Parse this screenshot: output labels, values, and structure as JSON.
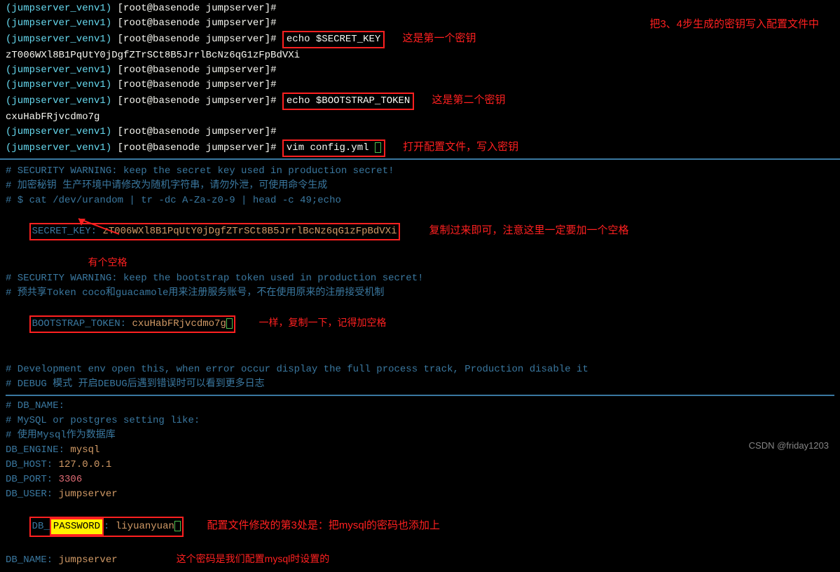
{
  "terminal": {
    "prompt_venv": "(jumpserver_venv1)",
    "prompt_user": "[root@basenode jumpserver]#",
    "cmd_echo_secret": "echo $SECRET_KEY",
    "secret_key_value": "zT006WXl8B1PqUtY0jDgfZTrSCt8B5JrrlBcNz6qG1zFpBdVXi",
    "cmd_echo_bootstrap": "echo $BOOTSTRAP_TOKEN",
    "bootstrap_value": "cxuHabFRjvcdmo7g",
    "cmd_vim": "vim config.yml"
  },
  "annotations": {
    "top_main": "把3、4步生成的密钥写入配置文件中",
    "first_key": "这是第一个密钥",
    "second_key": "这是第二个密钥",
    "open_config": "打开配置文件，写入密钥",
    "has_space": "有个空格",
    "copy_note": "复制过来即可，注意这里一定要加一个空格",
    "same_copy": "一样，复制一下，记得加空格",
    "mysql_note": "配置文件修改的第3处是：把mysql的密码也添加上",
    "mysql_note2": "这个密码是我们配置mysql时设置的"
  },
  "config": {
    "sec_warning1": "# SECURITY WARNING: keep the secret key used in production secret!",
    "sec_warning1_cn": "# 加密秘钥 生产环境中请修改为随机字符串，请勿外泄，可使用命令生成",
    "sec_gen_cmd": "# $ cat /dev/urandom | tr -dc A-Za-z0-9 | head -c 49;echo",
    "secret_key_label": "SECRET_KEY:",
    "secret_key_val": "zT006WXl8B1PqUtY0jDgfZTrSCt8B5JrrlBcNz6qG1zFpBdVXi",
    "sec_warning2": "# SECURITY WARNING: keep the bootstrap token used in production secret!",
    "sec_warning2_cn": "# 预共享Token coco和guacamole用来注册服务账号，不在使用原来的注册接受机制",
    "bootstrap_label": "BOOTSTRAP_TOKEN:",
    "bootstrap_val": "cxuHabFRjvcdmo7g",
    "dev_comment": "# Development env open this, when error occur display the full process track, Production disable it",
    "debug_comment": "# DEBUG 模式 开启DEBUG后遇到错误时可以看到更多日志",
    "db_name_comment": "# DB_NAME:",
    "db_setting_comment": "# MySQL or postgres setting like:",
    "db_use_comment": "# 使用Mysql作为数据库",
    "db_engine_k": "DB_ENGINE:",
    "db_engine_v": "mysql",
    "db_host_k": "DB_HOST:",
    "db_host_v": "127.0.0.1",
    "db_port_k": "DB_PORT:",
    "db_port_v": "3306",
    "db_user_k": "DB_USER:",
    "db_user_v": "jumpserver",
    "db_password_k": "DB_PASSWORD:",
    "db_password_v": "liyuanyuan",
    "db_name_k": "DB_NAME:",
    "db_name_v": "jumpserver"
  },
  "watermark": "CSDN @friday1203"
}
